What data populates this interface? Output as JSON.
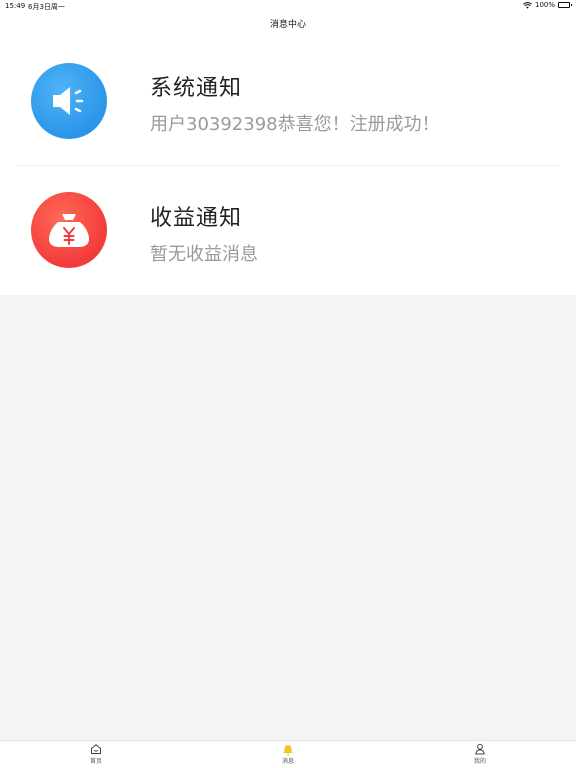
{
  "status_bar": {
    "time": "15:49",
    "date": "6月3日周一",
    "battery": "100%"
  },
  "nav": {
    "title": "消息中心"
  },
  "messages": [
    {
      "title": "系统通知",
      "body": "用户30392398恭喜您！注册成功！",
      "icon": "speaker-icon",
      "color": "#2b95e9"
    },
    {
      "title": "收益通知",
      "body": "暂无收益消息",
      "icon": "money-bag-icon",
      "color": "#f23b3b"
    }
  ],
  "tabs": [
    {
      "label": "首页",
      "icon": "home-icon"
    },
    {
      "label": "消息",
      "icon": "bell-icon",
      "active_color": "#f5c518"
    },
    {
      "label": "我的",
      "icon": "user-icon"
    }
  ]
}
